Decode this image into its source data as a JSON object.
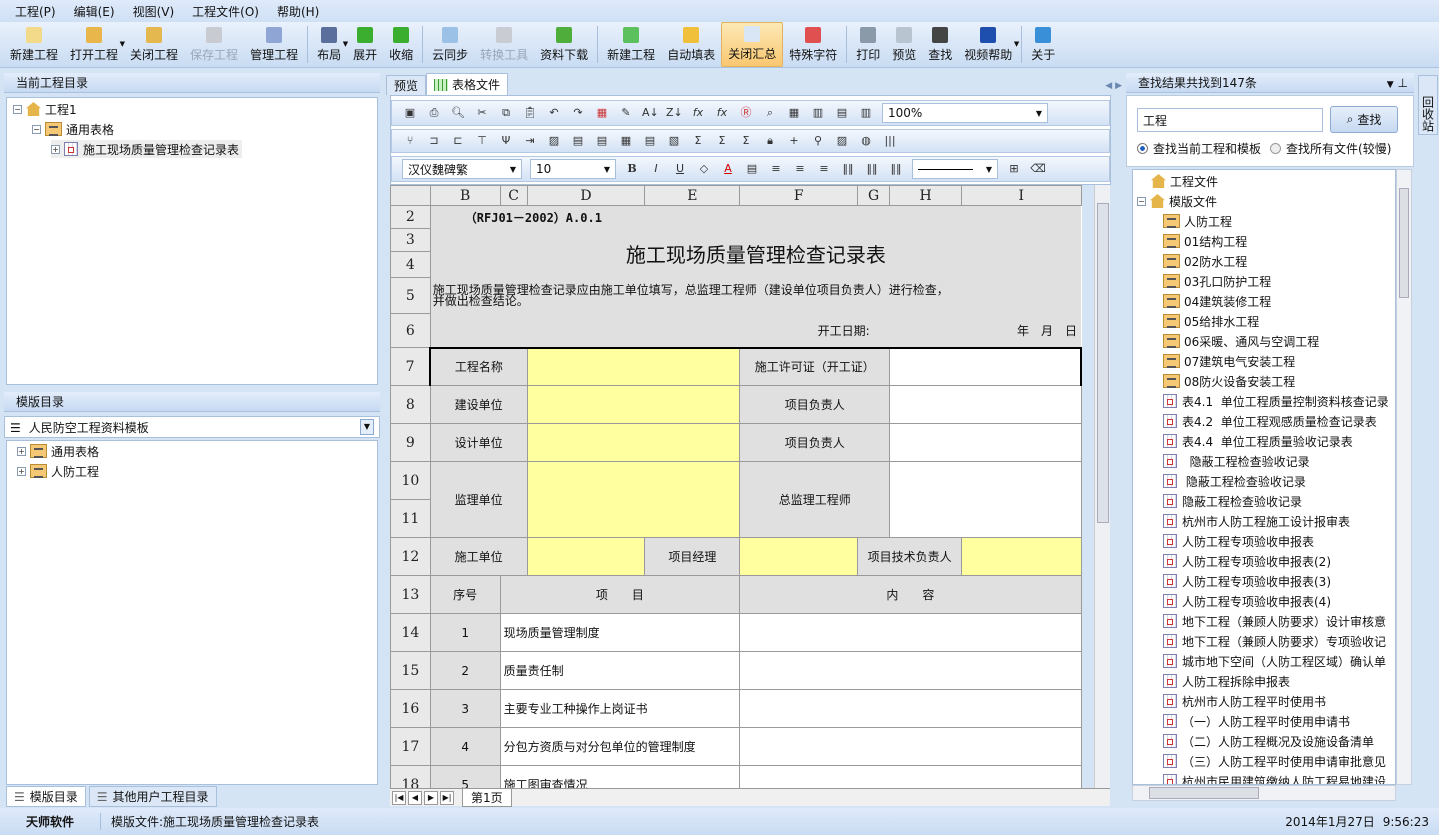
{
  "menu": [
    "工程(P)",
    "编辑(E)",
    "视图(V)",
    "工程文件(O)",
    "帮助(H)"
  ],
  "toolbar": [
    {
      "label": "新建工程",
      "icon": "new-project-icon",
      "color": "#f3d98a"
    },
    {
      "label": "打开工程",
      "icon": "open-folder-icon",
      "color": "#e9b64c",
      "dd": true
    },
    {
      "label": "关闭工程",
      "icon": "close-folder-icon",
      "color": "#e4b84f"
    },
    {
      "label": "保存工程",
      "icon": "save-icon",
      "color": "#c8ccd2",
      "disabled": true
    },
    {
      "label": "管理工程",
      "icon": "manage-icon",
      "color": "#8fa6d4",
      "sepAfter": true
    },
    {
      "label": "布局",
      "icon": "layout-icon",
      "color": "#5b6f9c",
      "dd": true
    },
    {
      "label": "展开",
      "icon": "plus-icon",
      "color": "#3cae2f"
    },
    {
      "label": "收缩",
      "icon": "minus-icon",
      "color": "#3cae2f",
      "sepAfter": true
    },
    {
      "label": "云同步",
      "icon": "globe-icon",
      "color": "#9bc2e6"
    },
    {
      "label": "转换工具",
      "icon": "convert-icon",
      "color": "#c9ccd2",
      "disabled": true
    },
    {
      "label": "资料下载",
      "icon": "download-icon",
      "color": "#4fae3b",
      "sepAfter": true
    },
    {
      "label": "新建工程",
      "icon": "new-sheet-icon",
      "color": "#5cc05c"
    },
    {
      "label": "自动填表",
      "icon": "pencil-icon",
      "color": "#f0c03a"
    },
    {
      "label": "关闭汇总",
      "icon": "summary-icon",
      "color": "#d8e6f6",
      "active": true
    },
    {
      "label": "特殊字符",
      "icon": "special-char-icon",
      "color": "#e05050",
      "sepAfter": true
    },
    {
      "label": "打印",
      "icon": "print-icon",
      "color": "#8a9aa8"
    },
    {
      "label": "预览",
      "icon": "preview-icon",
      "color": "#b8c4d0"
    },
    {
      "label": "查找",
      "icon": "binoculars-icon",
      "color": "#444"
    },
    {
      "label": "视频帮助",
      "icon": "video-icon",
      "color": "#1f4fae",
      "dd": true,
      "sepAfter": true
    },
    {
      "label": "关于",
      "icon": "help-icon",
      "color": "#3a8fd9"
    }
  ],
  "left": {
    "project_title": "当前工程目录",
    "project_tree": {
      "root": "工程1",
      "folder": "通用表格",
      "sheet": "施工现场质量管理检查记录表"
    },
    "template_title": "模版目录",
    "template_select": "人民防空工程资料模板",
    "template_tree": [
      "通用表格",
      "人防工程"
    ],
    "bottom_tabs": [
      "模版目录",
      "其他用户工程目录"
    ]
  },
  "center": {
    "tabs": [
      "预览",
      "表格文件"
    ],
    "zoom": "100%",
    "font": "汉仪魏碑繁",
    "font_size": "10",
    "sheet_tab": "第1页"
  },
  "sheet": {
    "cols": [
      "B",
      "C",
      "D",
      "E",
      "F",
      "G",
      "H",
      "I"
    ],
    "code": "（RFJ01－2002）A.0.1",
    "title": "施工现场质量管理检查记录表",
    "note1": "施工现场质量管理检查记录应由施工单位填写，总监理工程师（建设单位项目负责人）进行检查，",
    "note2": "并做出检查结论。",
    "start_date": "开工日期:",
    "date_fmt": "年　月　日",
    "project_name": "工程名称",
    "permit": "施工许可证（开工证）",
    "builder": "建设单位",
    "pm1": "项目负责人",
    "designer": "设计单位",
    "pm2": "项目负责人",
    "supervisor": "监理单位",
    "chief": "总监理工程师",
    "contractor": "施工单位",
    "manager": "项目经理",
    "tech": "项目技术负责人",
    "seq": "序号",
    "item": "项　　目",
    "content": "内　　容",
    "items": [
      {
        "n": "1",
        "t": "现场质量管理制度"
      },
      {
        "n": "2",
        "t": "质量责任制"
      },
      {
        "n": "3",
        "t": "主要专业工种操作上岗证书"
      },
      {
        "n": "4",
        "t": "分包方资质与对分包单位的管理制度"
      },
      {
        "n": "5",
        "t": "施工图审查情况"
      }
    ]
  },
  "right": {
    "title": "查找结果共找到147条",
    "search_value": "工程",
    "search_button": "查找",
    "radio1": "查找当前工程和模板",
    "radio2": "查找所有文件(较慢)",
    "side_tab": "回收站",
    "tree_top": [
      "工程文件",
      "模版文件"
    ],
    "folders": [
      "人防工程",
      "01结构工程",
      "02防水工程",
      "03孔口防护工程",
      "04建筑装修工程",
      "05给排水工程",
      "06采暖、通风与空调工程",
      "07建筑电气安装工程",
      "08防火设备安装工程"
    ],
    "sheets": [
      "表4.1  单位工程质量控制资料核查记录",
      "表4.2  单位工程观感质量检查记录表",
      "表4.4  单位工程质量验收记录表",
      "  隐蔽工程检查验收记录",
      " 隐蔽工程检查验收记录",
      "隐蔽工程检查验收记录",
      "杭州市人防工程施工设计报审表",
      "人防工程专项验收申报表",
      "人防工程专项验收申报表(2)",
      "人防工程专项验收申报表(3)",
      "人防工程专项验收申报表(4)",
      "地下工程（兼顾人防要求）设计审核意",
      "地下工程（兼顾人防要求）专项验收记",
      "城市地下空间（人防工程区域）确认单",
      "人防工程拆除申报表",
      "杭州市人防工程平时使用书",
      "（一）人防工程平时使用申请书",
      "（二）人防工程概况及设施设备清单",
      "（三）人防工程平时使用申请审批意见",
      "杭州市民用建筑缴纳人防工程易地建设"
    ]
  },
  "status": {
    "company": "天师软件",
    "file": "模版文件:施工现场质量管理检查记录表",
    "date": "2014年1月27日",
    "time": "9:56:23"
  }
}
